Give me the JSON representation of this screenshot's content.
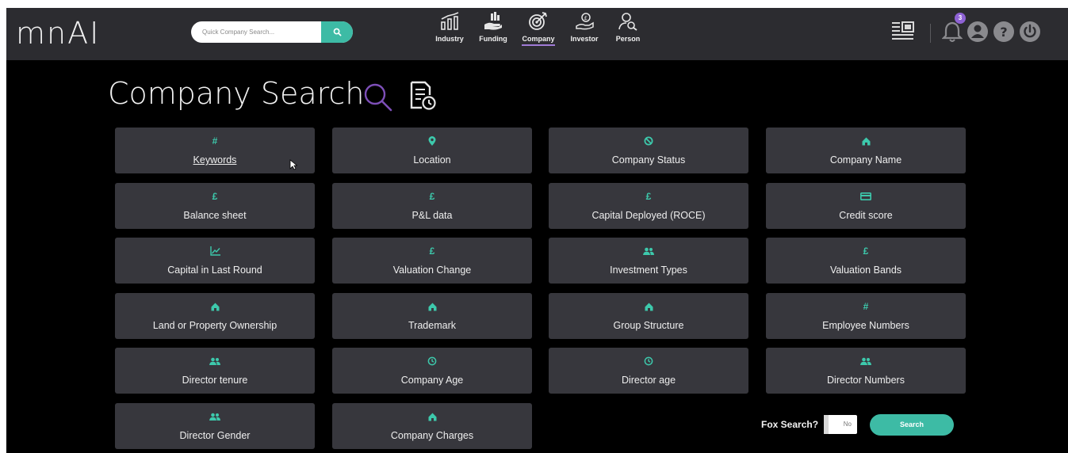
{
  "app": {
    "logo": "mnAI"
  },
  "header": {
    "quick_search": {
      "placeholder": "Quick Company Search...",
      "value": ""
    },
    "nav": [
      {
        "label": "Industry",
        "icon": "industry-chart-icon"
      },
      {
        "label": "Funding",
        "icon": "funding-hand-icon"
      },
      {
        "label": "Company",
        "icon": "company-target-icon",
        "active": true
      },
      {
        "label": "Investor",
        "icon": "investor-icon"
      },
      {
        "label": "Person",
        "icon": "person-search-icon"
      }
    ],
    "notifications_count": "3",
    "accent_color": "#3dbba5",
    "active_underline_color": "#a07bd6"
  },
  "page": {
    "title": "Company Search"
  },
  "filters": [
    {
      "label": "Keywords",
      "icon": "hash"
    },
    {
      "label": "Location",
      "icon": "pin"
    },
    {
      "label": "Company Status",
      "icon": "ban"
    },
    {
      "label": "Company Name",
      "icon": "house"
    },
    {
      "label": "Balance sheet",
      "icon": "pound"
    },
    {
      "label": "P&L data",
      "icon": "pound"
    },
    {
      "label": "Capital Deployed (ROCE)",
      "icon": "pound"
    },
    {
      "label": "Credit score",
      "icon": "card"
    },
    {
      "label": "Capital in Last Round",
      "icon": "chart"
    },
    {
      "label": "Valuation Change",
      "icon": "pound"
    },
    {
      "label": "Investment Types",
      "icon": "people"
    },
    {
      "label": "Valuation Bands",
      "icon": "pound"
    },
    {
      "label": "Land or Property Ownership",
      "icon": "house"
    },
    {
      "label": "Trademark",
      "icon": "house"
    },
    {
      "label": "Group Structure",
      "icon": "house"
    },
    {
      "label": "Employee Numbers",
      "icon": "hash"
    },
    {
      "label": "Director tenure",
      "icon": "people"
    },
    {
      "label": "Company Age",
      "icon": "clock"
    },
    {
      "label": "Director age",
      "icon": "clock"
    },
    {
      "label": "Director Numbers",
      "icon": "people"
    },
    {
      "label": "Director Gender",
      "icon": "people"
    },
    {
      "label": "Company Charges",
      "icon": "house"
    }
  ],
  "footer": {
    "fox_search_label": "Fox Search?",
    "fox_search_value": "No",
    "search_button": "Search"
  }
}
